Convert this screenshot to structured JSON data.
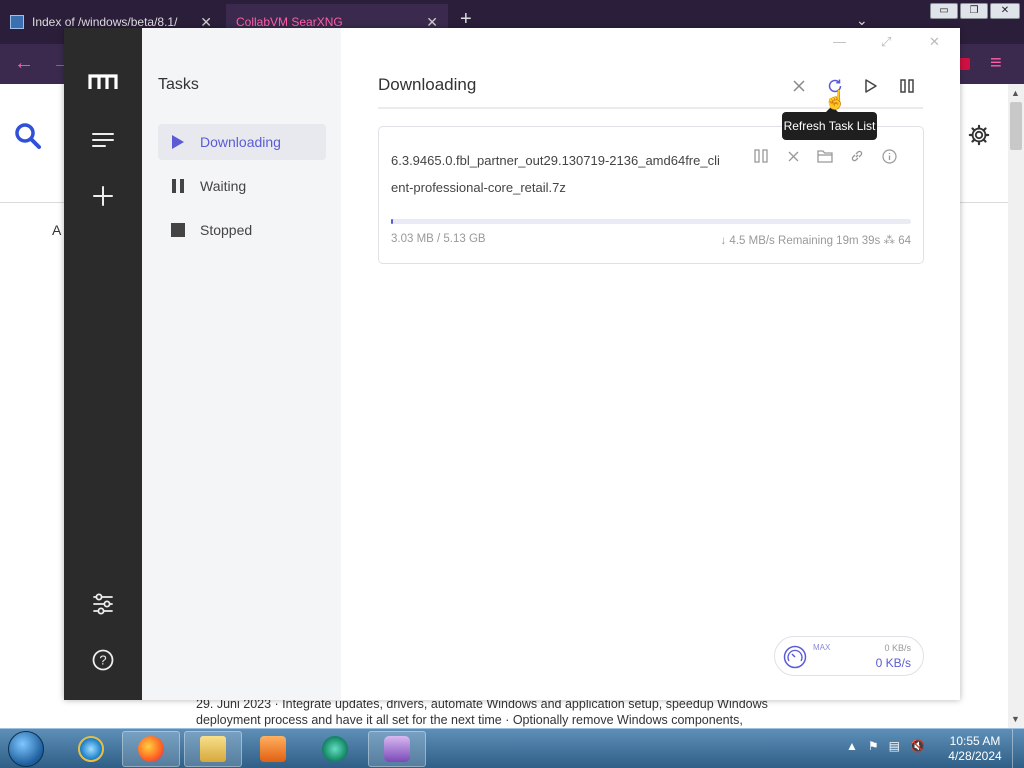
{
  "browser": {
    "tabs": [
      {
        "label": "Index of /windows/beta/8.1/",
        "close": "✕"
      },
      {
        "label": "CollabVM SearXNG",
        "close": "✕"
      }
    ],
    "new_tab": "+",
    "tab_menu": "⌄",
    "win": {
      "min": "▭",
      "max": "❐",
      "close": "✕"
    },
    "back": "←",
    "forward": "→",
    "menu": "≡"
  },
  "searx": {
    "ai_fragment": "A",
    "footer_lines": [
      "29. Juni 2023 · Integrate updates, drivers, automate Windows and application setup, speedup Windows",
      "deployment process and have it all set for the next time · Optionally remove Windows components,"
    ]
  },
  "motrix": {
    "sidebar": {
      "title": "Tasks",
      "items": [
        {
          "label": "Downloading",
          "icon": "play-icon",
          "active": true
        },
        {
          "label": "Waiting",
          "icon": "pause-icon",
          "active": false
        },
        {
          "label": "Stopped",
          "icon": "stop-icon",
          "active": false
        }
      ]
    },
    "rail_icons": [
      "motrix-logo",
      "menu-icon",
      "add-icon",
      "settings-sliders-icon",
      "help-icon"
    ],
    "help_glyph": "?",
    "header": {
      "title": "Downloading",
      "tooltip": "Refresh Task List"
    },
    "task": {
      "filename": "6.3.9465.0.fbl_partner_out29.130719-2136_amd64fre_client-professional-core_retail.7z",
      "progress_fraction": 0.0006,
      "size": "3.03 MB / 5.13 GB",
      "speed": "↓ 4.5 MB/s",
      "remaining": "Remaining 19m 39s",
      "connections": "⁂ 64"
    },
    "speed": {
      "max_label": "MAX",
      "upload": "0 KB/s",
      "download": "0 KB/s"
    },
    "accent": "#5b5bd6"
  },
  "taskbar": {
    "clock_time": "10:55 AM",
    "clock_date": "4/28/2024"
  }
}
